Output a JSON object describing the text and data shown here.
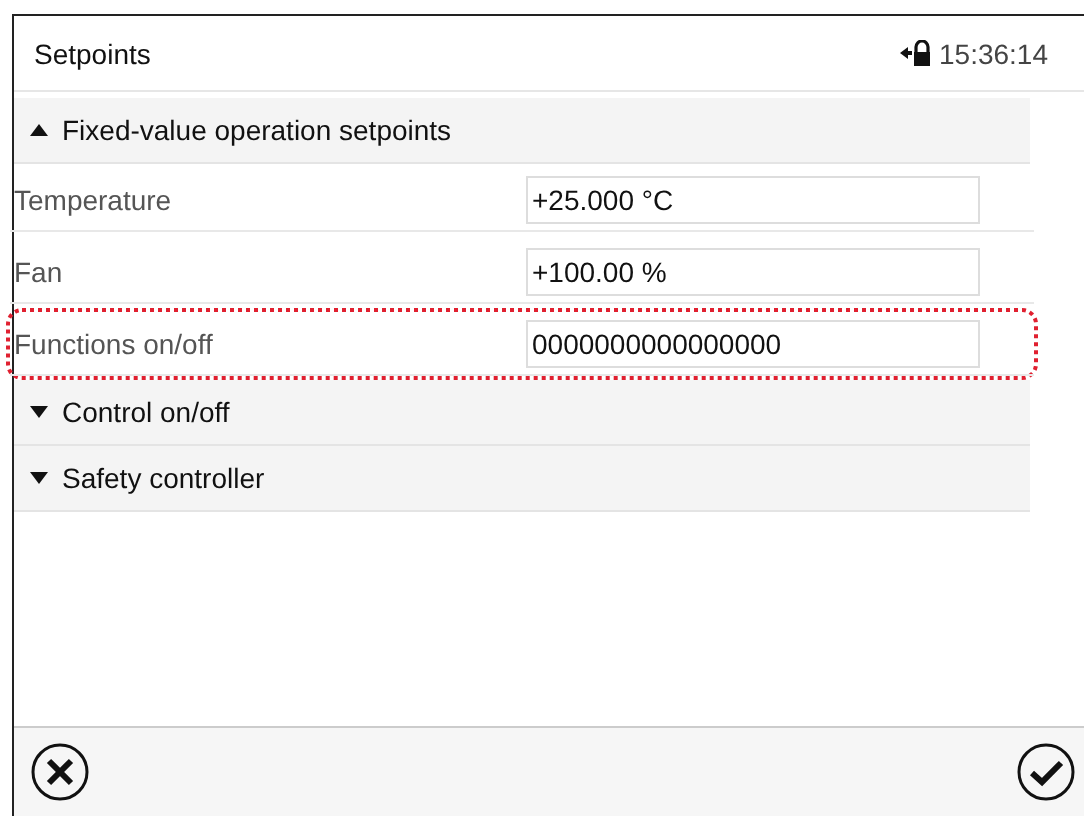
{
  "header": {
    "title": "Setpoints",
    "time": "15:36:14"
  },
  "sections": [
    {
      "label": "Fixed-value operation setpoints",
      "expanded": true,
      "rows": [
        {
          "label": "Temperature",
          "value": "+25.000 °C",
          "highlighted": false
        },
        {
          "label": "Fan",
          "value": "+100.00 %",
          "highlighted": false
        },
        {
          "label": "Functions on/off",
          "value": "0000000000000000",
          "highlighted": true
        }
      ]
    },
    {
      "label": "Control on/off",
      "expanded": false
    },
    {
      "label": "Safety controller",
      "expanded": false
    }
  ],
  "footer": {
    "buttons": [
      {
        "kind": "cancel"
      },
      {
        "kind": "confirm"
      }
    ]
  }
}
